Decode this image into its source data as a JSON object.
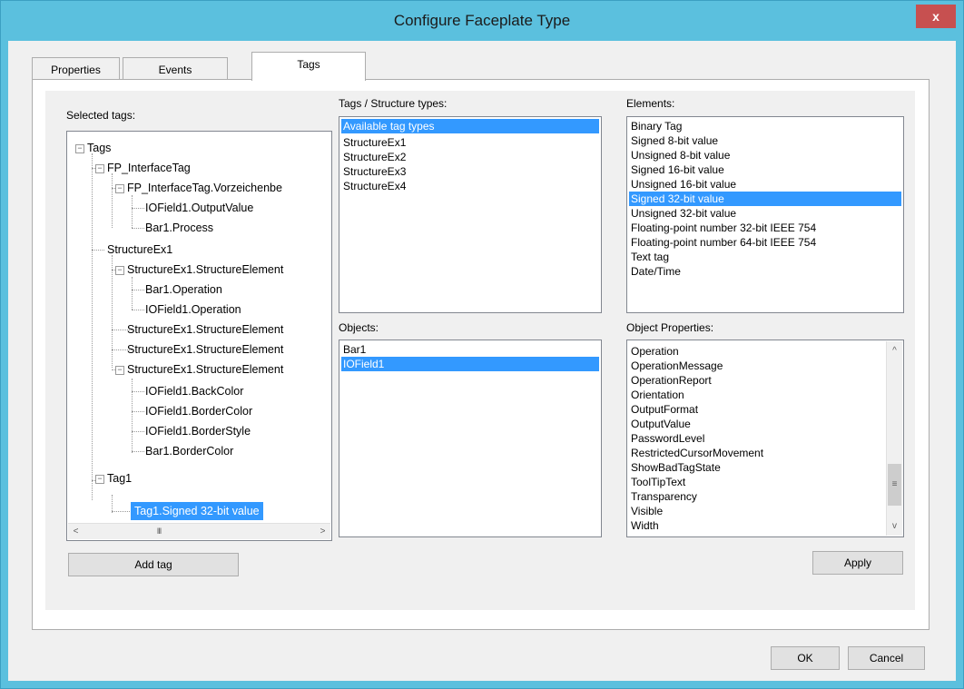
{
  "window": {
    "title": "Configure Faceplate Type",
    "close_glyph": "x"
  },
  "tabs": [
    {
      "label": "Properties",
      "active": false
    },
    {
      "label": "Events",
      "active": false
    },
    {
      "label": "Tags",
      "active": true
    }
  ],
  "selected_tags": {
    "label": "Selected tags:",
    "tree": [
      "Tags",
      "FP_InterfaceTag",
      "FP_InterfaceTag.Vorzeichenbe",
      "IOField1.OutputValue",
      "Bar1.Process",
      "StructureEx1",
      "StructureEx1.StructureElement",
      "Bar1.Operation",
      "IOField1.Operation",
      "StructureEx1.StructureElement",
      "StructureEx1.StructureElement",
      "StructureEx1.StructureElement",
      "IOField1.BackColor",
      "IOField1.BorderColor",
      "IOField1.BorderStyle",
      "Bar1.BorderColor",
      "Tag1",
      "Tag1.Signed 32-bit value"
    ],
    "selected_item": "Tag1.Signed 32-bit value",
    "scroll_left": "<",
    "scroll_right": ">",
    "scroll_thumb": "III"
  },
  "tag_types": {
    "label": "Tags / Structure types:",
    "items": [
      "Available tag types",
      "StructureEx1",
      "StructureEx2",
      "StructureEx3",
      "StructureEx4"
    ],
    "selected_item": "Available tag types"
  },
  "elements": {
    "label": "Elements:",
    "items": [
      "Binary Tag",
      "Signed 8-bit value",
      "Unsigned 8-bit value",
      "Signed 16-bit value",
      "Unsigned 16-bit value",
      "Signed 32-bit value",
      "Unsigned 32-bit value",
      "Floating-point number 32-bit IEEE 754",
      "Floating-point number 64-bit IEEE 754",
      "Text tag",
      "Date/Time"
    ],
    "selected_item": "Signed 32-bit value"
  },
  "objects": {
    "label": "Objects:",
    "items": [
      "Bar1",
      "IOField1"
    ],
    "selected_item": "IOField1"
  },
  "object_properties": {
    "label": "Object Properties:",
    "items": [
      "Operation",
      "OperationMessage",
      "OperationReport",
      "Orientation",
      "OutputFormat",
      "OutputValue",
      "PasswordLevel",
      "RestrictedCursorMovement",
      "ShowBadTagState",
      "ToolTipText",
      "Transparency",
      "Visible",
      "Width"
    ],
    "scroll_up": "^",
    "scroll_down": "v",
    "scroll_thumb": "≡"
  },
  "buttons": {
    "add_tag": "Add tag",
    "apply": "Apply",
    "ok": "OK",
    "cancel": "Cancel"
  },
  "colors": {
    "title_bar": "#5bc0de",
    "selection": "#3399ff",
    "close": "#c75050"
  }
}
